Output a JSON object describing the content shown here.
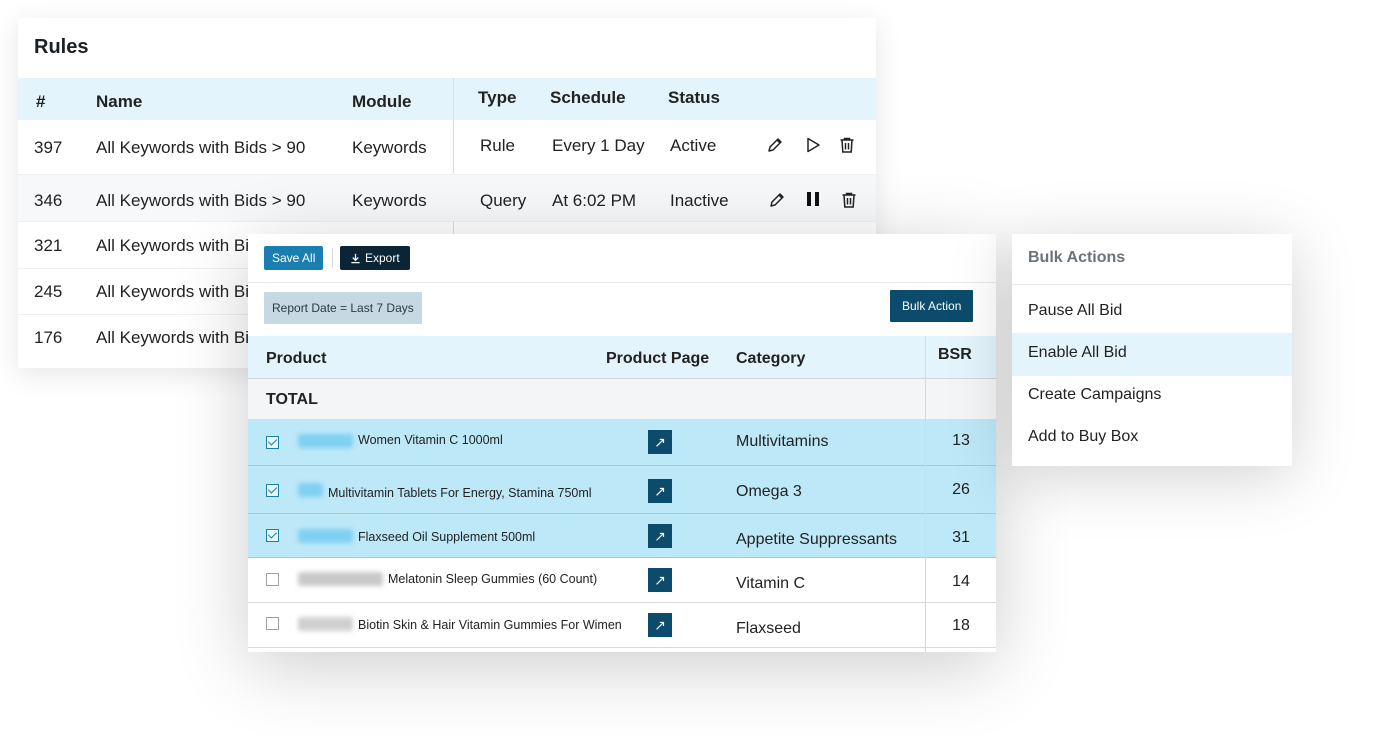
{
  "rules": {
    "title": "Rules",
    "columns": {
      "num": "#",
      "name": "Name",
      "module": "Module",
      "type": "Type",
      "schedule": "Schedule",
      "status": "Status"
    },
    "rows": [
      {
        "id": "397",
        "name": "All Keywords with Bids > 90",
        "module": "Keywords",
        "type": "Rule",
        "schedule": "Every 1 Day",
        "status": "Active",
        "toggle": "play"
      },
      {
        "id": "346",
        "name": "All Keywords with Bids > 90",
        "module": "Keywords",
        "type": "Query",
        "schedule": "At 6:02 PM",
        "status": "Inactive",
        "toggle": "pause"
      },
      {
        "id": "321",
        "name": "All Keywords with Bi"
      },
      {
        "id": "245",
        "name": "All Keywords with Bi"
      },
      {
        "id": "176",
        "name": "All Keywords with Bi"
      }
    ]
  },
  "products": {
    "toolbar": {
      "save_all": "Save All",
      "export": "Export"
    },
    "report_date": "Report Date = Last 7 Days",
    "bulk_action": "Bulk Action",
    "columns": {
      "product": "Product",
      "product_page": "Product Page",
      "category": "Category",
      "bsr": "BSR"
    },
    "total_label": "TOTAL",
    "rows": [
      {
        "checked": true,
        "name": "Women Vitamin C 1000ml",
        "category": "Multivitamins",
        "bsr": "13"
      },
      {
        "checked": true,
        "name": "Multivitamin Tablets For Energy, Stamina 750ml",
        "category": "Omega 3",
        "bsr": "26"
      },
      {
        "checked": true,
        "name": "Flaxseed Oil Supplement 500ml",
        "category": "Appetite Suppressants",
        "bsr": "31"
      },
      {
        "checked": false,
        "name": "Melatonin Sleep Gummies (60 Count)",
        "category": "Vitamin C",
        "bsr": "14"
      },
      {
        "checked": false,
        "name": "Biotin Skin & Hair Vitamin Gummies For Wimen",
        "category": "Flaxseed",
        "bsr": "18"
      }
    ],
    "link_icon": "arrow-up-right-icon"
  },
  "bulk_menu": {
    "title": "Bulk Actions",
    "items": [
      "Pause All Bid",
      "Enable All Bid",
      "Create Campaigns",
      "Add to Buy Box"
    ],
    "active_item": "Enable All Bid"
  },
  "colors": {
    "header_bg": "#e3f4fc",
    "selected_row": "#bde8f8",
    "primary_dark": "#0c4b6b",
    "save_blue": "#1a7fb0"
  }
}
